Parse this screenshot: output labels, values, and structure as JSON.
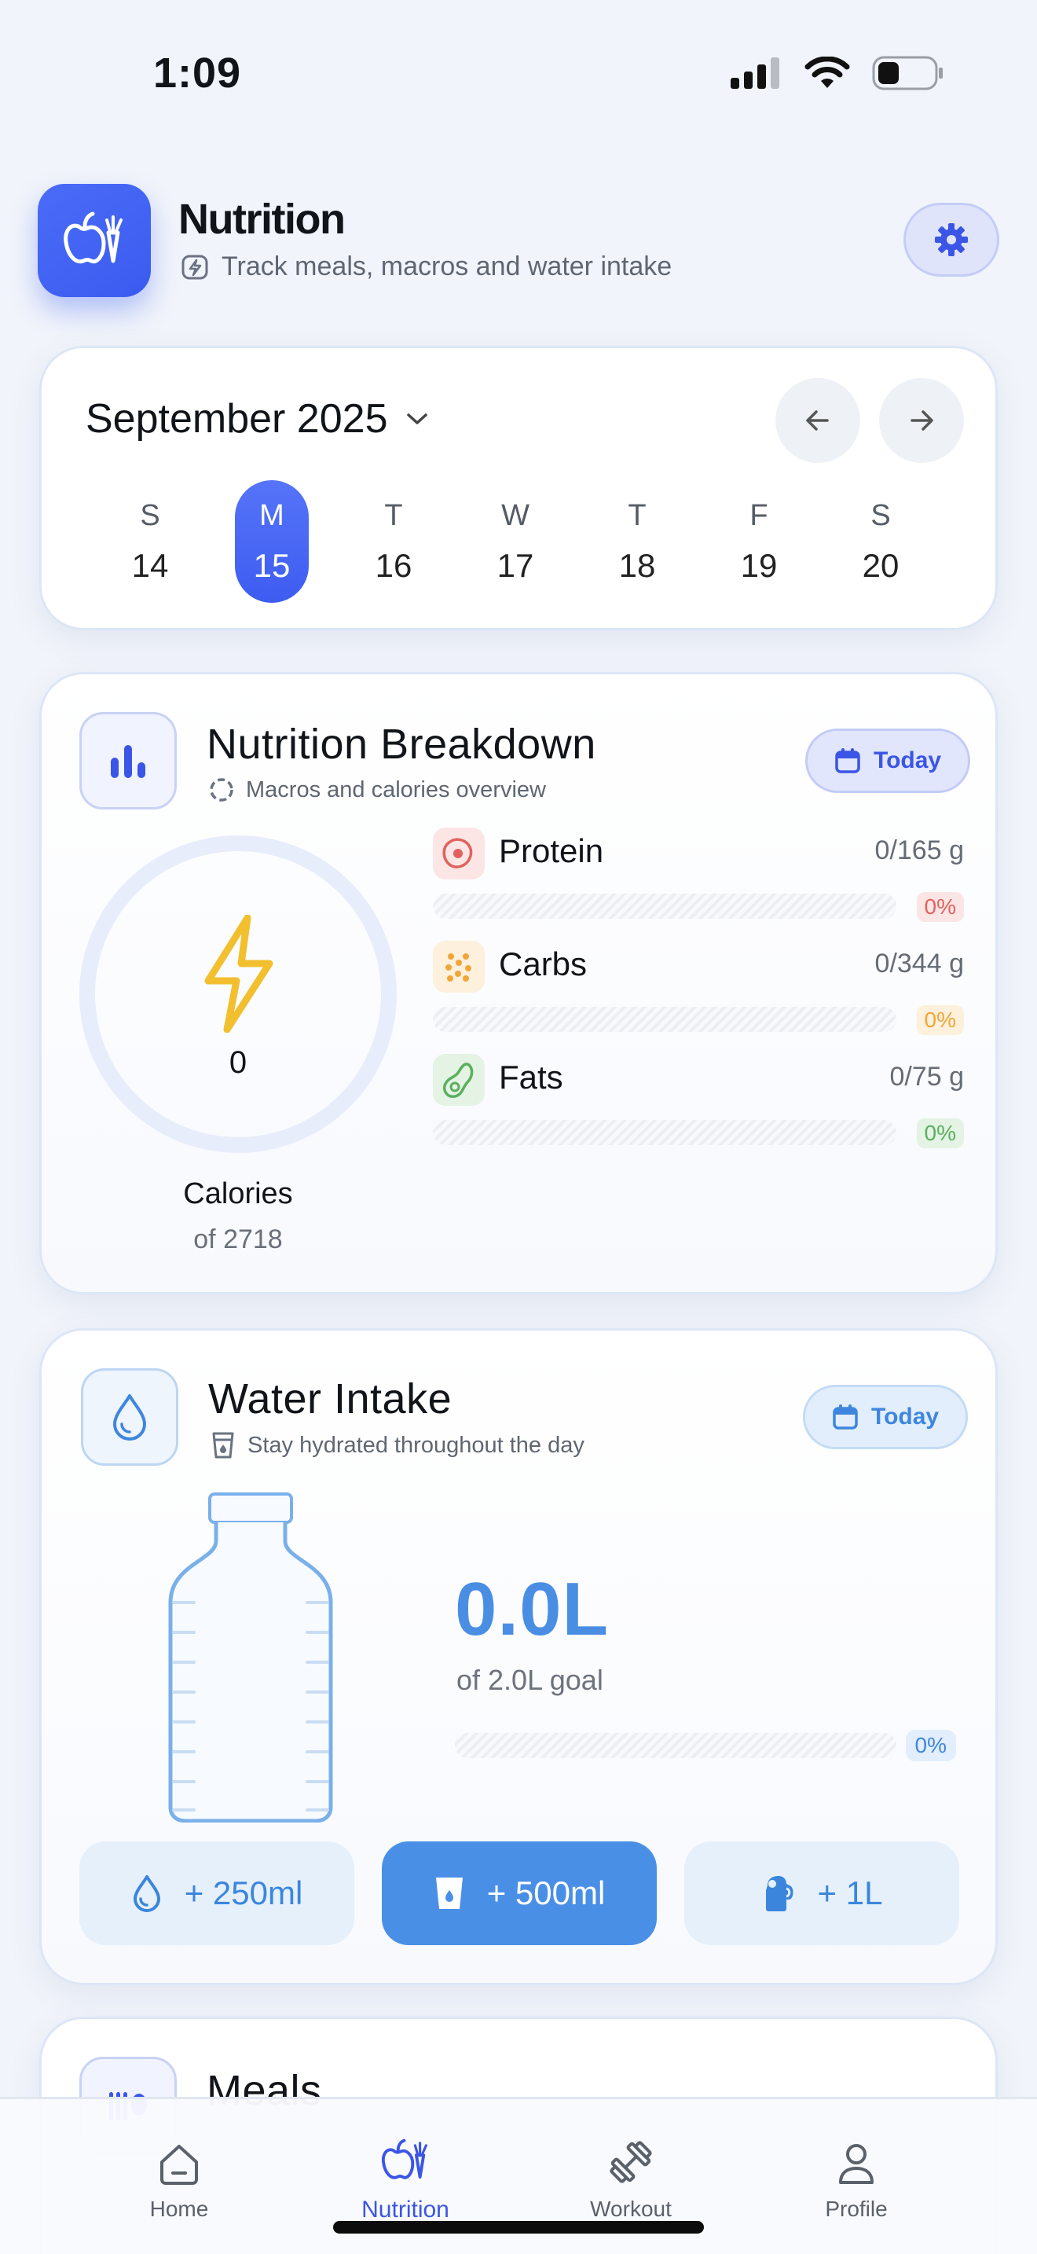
{
  "status_bar": {
    "time": "1:09"
  },
  "header": {
    "title": "Nutrition",
    "subtitle": "Track meals, macros and water intake"
  },
  "calendar": {
    "month": "September 2025",
    "days": [
      {
        "dow": "S",
        "num": "14"
      },
      {
        "dow": "M",
        "num": "15",
        "selected": true
      },
      {
        "dow": "T",
        "num": "16"
      },
      {
        "dow": "W",
        "num": "17"
      },
      {
        "dow": "T",
        "num": "18"
      },
      {
        "dow": "F",
        "num": "19"
      },
      {
        "dow": "S",
        "num": "20"
      }
    ]
  },
  "nutrition": {
    "title": "Nutrition Breakdown",
    "subtitle": "Macros and calories overview",
    "today_label": "Today",
    "calories": {
      "value": "0",
      "label": "Calories",
      "goal": "of 2718"
    },
    "macros": [
      {
        "name": "Protein",
        "value": "0/165 g",
        "pct": "0%",
        "color": "#e0625e"
      },
      {
        "name": "Carbs",
        "value": "0/344 g",
        "pct": "0%",
        "color": "#f0a638"
      },
      {
        "name": "Fats",
        "value": "0/75 g",
        "pct": "0%",
        "color": "#5bb05e"
      }
    ]
  },
  "water": {
    "title": "Water Intake",
    "subtitle": "Stay hydrated throughout the day",
    "today_label": "Today",
    "amount": "0.0L",
    "goal": "of 2.0L goal",
    "pct": "0%",
    "buttons": [
      "+ 250ml",
      "+ 500ml",
      "+ 1L"
    ]
  },
  "meals": {
    "title": "Meals"
  },
  "tabbar": {
    "items": [
      {
        "label": "Home"
      },
      {
        "label": "Nutrition",
        "active": true
      },
      {
        "label": "Workout"
      },
      {
        "label": "Profile"
      }
    ]
  },
  "colors": {
    "accent": "#3b55e6",
    "water": "#4a8ee4",
    "background": "#f1f4fa"
  }
}
